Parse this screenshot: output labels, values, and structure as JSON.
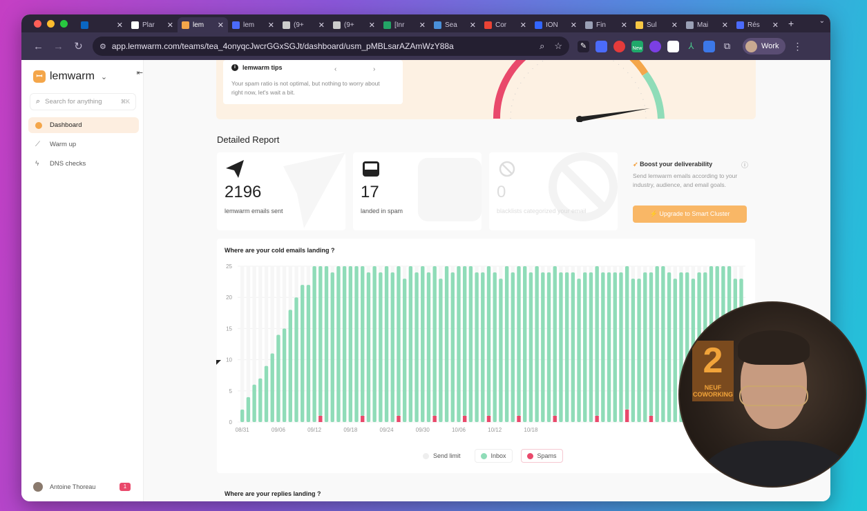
{
  "browser": {
    "tabs": [
      {
        "label": "",
        "icon": "linkedin-icon",
        "color": "#0a66c2",
        "active": false
      },
      {
        "label": "Plar",
        "icon": "threads-icon",
        "color": "#ffffff",
        "active": false
      },
      {
        "label": "lem",
        "icon": "lemwarm-icon",
        "color": "#f4a64a",
        "active": true
      },
      {
        "label": "lem",
        "icon": "lemlist-icon",
        "color": "#4b6bfb",
        "active": false
      },
      {
        "label": "(9+",
        "icon": "gear-icon",
        "color": "#cccccc",
        "active": false
      },
      {
        "label": "(9+",
        "icon": "gear-icon",
        "color": "#cccccc",
        "active": false
      },
      {
        "label": "[Inr",
        "icon": "sheets-icon",
        "color": "#23a566",
        "active": false
      },
      {
        "label": "Sea",
        "icon": "search-console-icon",
        "color": "#4a90d9",
        "active": false
      },
      {
        "label": "Cor",
        "icon": "google-icon",
        "color": "#ea4335",
        "active": false
      },
      {
        "label": "ION",
        "icon": "ion-icon",
        "color": "#3366ff",
        "active": false
      },
      {
        "label": "Fin",
        "icon": "link-icon",
        "color": "#9aa0b5",
        "active": false
      },
      {
        "label": "Sul",
        "icon": "sparkle-icon",
        "color": "#f6c744",
        "active": false
      },
      {
        "label": "Mai",
        "icon": "link-icon",
        "color": "#9aa0b5",
        "active": false
      },
      {
        "label": "Rés",
        "icon": "lemlist-icon",
        "color": "#4b6bfb",
        "active": false
      }
    ],
    "url": "app.lemwarm.com/teams/tea_4onyqcJwcrGGxSGJt/dashboard/usm_pMBLsarAZAmWzY88a",
    "profile_label": "Work",
    "extension_badge": "New"
  },
  "sidebar": {
    "brand": "lemwarm",
    "search_placeholder": "Search for anything",
    "search_shortcut": "⌘K",
    "items": [
      {
        "label": "Dashboard",
        "icon": "dashboard-icon",
        "active": true
      },
      {
        "label": "Warm up",
        "icon": "chart-line-icon",
        "active": false
      },
      {
        "label": "DNS checks",
        "icon": "bolt-icon",
        "active": false
      }
    ],
    "user_name": "Antoine Thoreau",
    "user_badge": "1"
  },
  "tips": {
    "title": "lemwarm tips",
    "text": "Your spam ratio is not optimal, but nothing to worry about right now, let's wait a bit."
  },
  "report": {
    "title": "Detailed Report",
    "stats": [
      {
        "value": "2196",
        "label": "lemwarm emails sent",
        "icon": "paper-plane-icon"
      },
      {
        "value": "17",
        "label": "landed in spam",
        "icon": "inbox-icon"
      },
      {
        "value": "0",
        "label": "blacklists categorized your email",
        "icon": "blocked-icon"
      }
    ],
    "boost": {
      "title": "Boost your deliverability",
      "text": "Send lemwarm emails according to your industry, audience, and email goals.",
      "button": "Upgrade to Smart Cluster"
    }
  },
  "chart_section": {
    "title": "Where are your cold emails landing ?",
    "legend": [
      "Send limit",
      "Inbox",
      "Spams"
    ]
  },
  "replies_title": "Where are your replies landing ?",
  "colors": {
    "inbox": "#8fdcb8",
    "spam": "#e9496b",
    "send_limit": "#eeeeee",
    "accent": "#f4a64a"
  },
  "chart_data": {
    "type": "bar",
    "stacked": true,
    "ylim": [
      0,
      25
    ],
    "yticks": [
      0,
      5,
      10,
      15,
      20,
      25
    ],
    "xtick_labels": [
      "08/31",
      "09/06",
      "09/12",
      "09/18",
      "09/24",
      "09/30",
      "10/06",
      "10/12",
      "10/18"
    ],
    "series": [
      {
        "name": "Inbox",
        "values": [
          2,
          4,
          6,
          7,
          9,
          11,
          14,
          15,
          18,
          20,
          22,
          22,
          25,
          25,
          25,
          24,
          25,
          25,
          26,
          25,
          24,
          24,
          25,
          24,
          25,
          24,
          24,
          23,
          25,
          24,
          25,
          24,
          25,
          23,
          25,
          24,
          25,
          24,
          25,
          24,
          24,
          25,
          24,
          23,
          25,
          24,
          24,
          25,
          24,
          25,
          24,
          24,
          25,
          24,
          24,
          24,
          23,
          24,
          24,
          25,
          24,
          24,
          24,
          24,
          24,
          23,
          23,
          24,
          23,
          25,
          25,
          24,
          23,
          24,
          24,
          23,
          24,
          24,
          25,
          25,
          25,
          25,
          23,
          23
        ]
      },
      {
        "name": "Spams",
        "values": [
          0,
          0,
          0,
          0,
          0,
          0,
          0,
          0,
          0,
          0,
          0,
          0,
          0,
          1,
          0,
          0,
          0,
          0,
          0,
          0,
          1,
          0,
          0,
          0,
          0,
          0,
          1,
          0,
          0,
          0,
          0,
          0,
          1,
          0,
          0,
          0,
          0,
          1,
          0,
          0,
          0,
          1,
          0,
          0,
          0,
          0,
          1,
          0,
          0,
          0,
          0,
          0,
          1,
          0,
          0,
          0,
          0,
          0,
          0,
          1,
          0,
          0,
          0,
          0,
          2,
          0,
          0,
          0,
          1,
          0,
          0,
          0,
          0,
          0,
          0,
          0,
          0,
          0,
          0,
          0,
          0,
          0,
          0,
          0
        ]
      }
    ]
  }
}
